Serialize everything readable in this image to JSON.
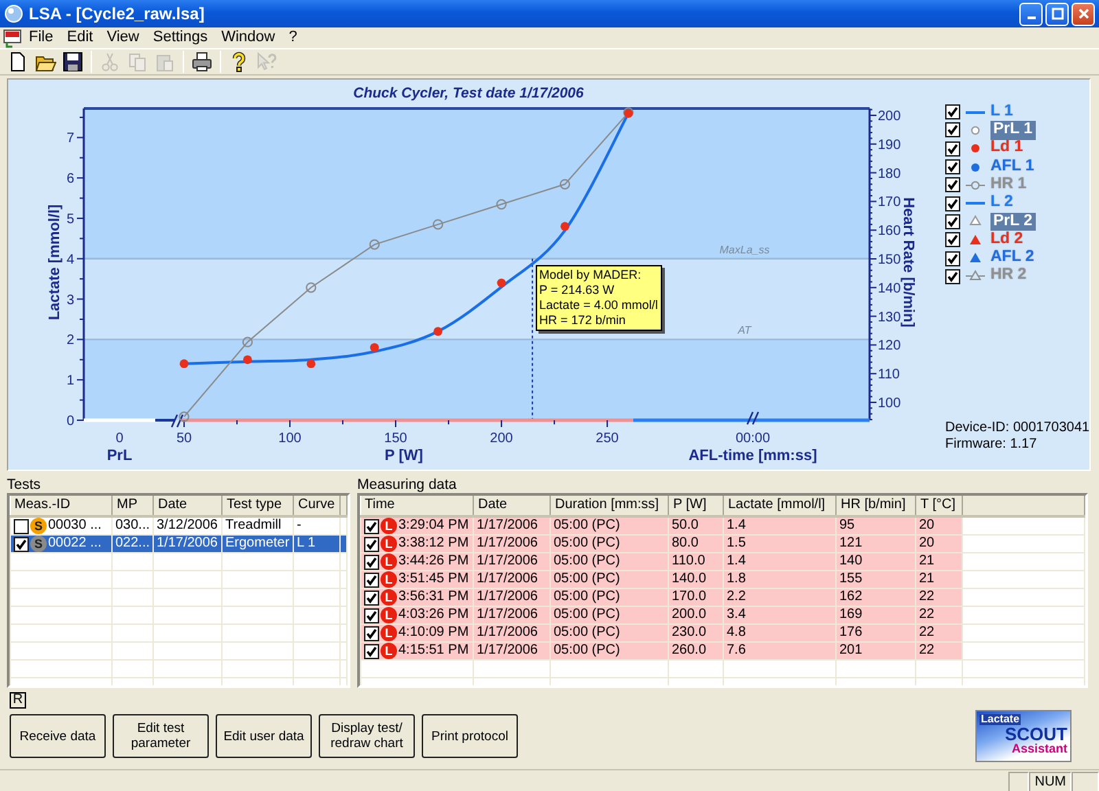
{
  "window": {
    "title": "LSA - [Cycle2_raw.lsa]"
  },
  "menu": [
    "File",
    "Edit",
    "View",
    "Settings",
    "Window",
    "?"
  ],
  "toolbar": [
    {
      "kind": "new",
      "disabled": false
    },
    {
      "kind": "open",
      "disabled": false
    },
    {
      "kind": "save",
      "disabled": false
    },
    {
      "kind": "separator"
    },
    {
      "kind": "cut",
      "disabled": true
    },
    {
      "kind": "copy",
      "disabled": true
    },
    {
      "kind": "paste",
      "disabled": true
    },
    {
      "kind": "separator"
    },
    {
      "kind": "print",
      "disabled": false
    },
    {
      "kind": "separator"
    },
    {
      "kind": "help",
      "disabled": false
    },
    {
      "kind": "context-help",
      "disabled": true
    }
  ],
  "chart": {
    "chart_data": {
      "type": "line",
      "title": "Chuck Cycler, Test date 1/17/2006",
      "xlabel": "P [W]",
      "ylabel": "Lactate [mmol/l]",
      "y2label": "Heart Rate [b/min]",
      "x": [
        50,
        80,
        110,
        140,
        170,
        200,
        230,
        260
      ],
      "xlim": [
        2.6,
        374.0
      ],
      "ylim": [
        0,
        7.72
      ],
      "y2lim": [
        93.78,
        202.39
      ],
      "xticks": [
        50,
        100,
        150,
        200,
        250
      ],
      "yticks": [
        0,
        1,
        2,
        3,
        4,
        5,
        6,
        7
      ],
      "y2ticks": [
        100,
        110,
        120,
        130,
        140,
        150,
        160,
        170,
        180,
        190,
        200
      ],
      "series": [
        {
          "type": "line",
          "color": "#1a6ee8",
          "values": [
            1.4,
            1.45,
            1.5,
            1.7,
            2.2,
            3.3,
            4.7,
            7.6
          ]
        },
        {
          "type": "scatter",
          "color": "#e8301c",
          "values": [
            1.4,
            1.5,
            1.4,
            1.8,
            2.2,
            3.4,
            4.8,
            7.6
          ]
        },
        {
          "type": "line",
          "marker": "circle",
          "axis": "y2",
          "color": "#8a8a8a",
          "values": [
            95,
            121,
            140,
            155,
            162,
            169,
            176,
            201
          ]
        }
      ],
      "bands": [
        {
          "axis": "y",
          "from": 2.0,
          "to": 4.0
        }
      ],
      "ref_lines": [
        {
          "axis": "y",
          "value": 4.0,
          "label": "MaxLa_ss"
        },
        {
          "axis": "y",
          "value": 2.0,
          "label": "AT"
        }
      ],
      "annotations": [
        {
          "text": "Model by MADER:\nP = 214.63 W\nLactate = 4.00 mmol/l\nHR = 172 b/min",
          "x": 214.63,
          "y": 4.0
        }
      ]
    },
    "axis_sections": [
      {
        "label": "PrL",
        "tick": "0"
      },
      {
        "label": "AFL-time [mm:ss]",
        "tick": "00:00"
      }
    ],
    "legend": [
      {
        "label": "L 1",
        "checked": true,
        "kind": "line",
        "color": "#1e7cf0"
      },
      {
        "label": "PrL 1",
        "checked": true,
        "kind": "circle",
        "color": "#ffffff"
      },
      {
        "label": "Ld 1",
        "checked": true,
        "kind": "dot",
        "color": "#e8301c"
      },
      {
        "label": "AFL 1",
        "checked": true,
        "kind": "dot",
        "color": "#1e6ee0"
      },
      {
        "label": "HR 1",
        "checked": true,
        "kind": "line-circle",
        "color": "#909090"
      },
      {
        "label": "L 2",
        "checked": true,
        "kind": "line",
        "color": "#1e7cf0"
      },
      {
        "label": "PrL 2",
        "checked": true,
        "kind": "triangle-open",
        "color": "#ffffff"
      },
      {
        "label": "Ld 2",
        "checked": true,
        "kind": "triangle",
        "color": "#e8301c"
      },
      {
        "label": "AFL 2",
        "checked": true,
        "kind": "triangle",
        "color": "#1e6ee0"
      },
      {
        "label": "HR 2",
        "checked": true,
        "kind": "line-triangle",
        "color": "#909090"
      }
    ],
    "device_id": "Device-ID: 0001703041",
    "firmware": "Firmware: 1.17"
  },
  "tests": {
    "label": "Tests",
    "columns": [
      "Meas.-ID",
      "MP",
      "Date",
      "Test type",
      "Curve"
    ],
    "rows": [
      {
        "checked": false,
        "selected": false,
        "badge": "S",
        "color": "#f5a000",
        "cells": [
          "00030 ...",
          "030...",
          "3/12/2006",
          "Treadmill",
          "-"
        ]
      },
      {
        "checked": true,
        "selected": true,
        "badge": "S",
        "color": "#8a8a8a",
        "cells": [
          "00022 ...",
          "022...",
          "1/17/2006",
          "Ergometer",
          "L 1"
        ]
      }
    ]
  },
  "measuring": {
    "label": "Measuring data",
    "columns": [
      "Time",
      "Date",
      "Duration [mm:ss]",
      "P [W]",
      "Lactate [mmol/l]",
      "HR [b/min]",
      "T [°C]"
    ],
    "rows": [
      {
        "checked": true,
        "highlighted": true,
        "badge": "L",
        "cells": [
          "3:29:04 PM",
          "1/17/2006",
          "05:00 (PC)",
          "50.0",
          "1.4",
          "95",
          "20"
        ]
      },
      {
        "checked": true,
        "highlighted": true,
        "badge": "L",
        "cells": [
          "3:38:12 PM",
          "1/17/2006",
          "05:00 (PC)",
          "80.0",
          "1.5",
          "121",
          "20"
        ]
      },
      {
        "checked": true,
        "highlighted": true,
        "badge": "L",
        "cells": [
          "3:44:26 PM",
          "1/17/2006",
          "05:00 (PC)",
          "110.0",
          "1.4",
          "140",
          "21"
        ]
      },
      {
        "checked": true,
        "highlighted": true,
        "badge": "L",
        "cells": [
          "3:51:45 PM",
          "1/17/2006",
          "05:00 (PC)",
          "140.0",
          "1.8",
          "155",
          "21"
        ]
      },
      {
        "checked": true,
        "highlighted": true,
        "badge": "L",
        "cells": [
          "3:56:31 PM",
          "1/17/2006",
          "05:00 (PC)",
          "170.0",
          "2.2",
          "162",
          "22"
        ]
      },
      {
        "checked": true,
        "highlighted": true,
        "badge": "L",
        "cells": [
          "4:03:26 PM",
          "1/17/2006",
          "05:00 (PC)",
          "200.0",
          "3.4",
          "169",
          "22"
        ]
      },
      {
        "checked": true,
        "highlighted": true,
        "badge": "L",
        "cells": [
          "4:10:09 PM",
          "1/17/2006",
          "05:00 (PC)",
          "230.0",
          "4.8",
          "176",
          "22"
        ]
      },
      {
        "checked": true,
        "highlighted": true,
        "badge": "L",
        "cells": [
          "4:15:51 PM",
          "1/17/2006",
          "05:00 (PC)",
          "260.0",
          "7.6",
          "201",
          "22"
        ]
      }
    ]
  },
  "indicator": "R",
  "buttons": [
    "Receive data",
    "Edit test parameter",
    "Edit user data",
    "Display test/ redraw chart",
    "Print protocol"
  ],
  "logo": {
    "brand": "Lactate",
    "name": "SCOUT",
    "tagline": "Assistant"
  },
  "status_bar": {
    "indicator": "NUM"
  }
}
